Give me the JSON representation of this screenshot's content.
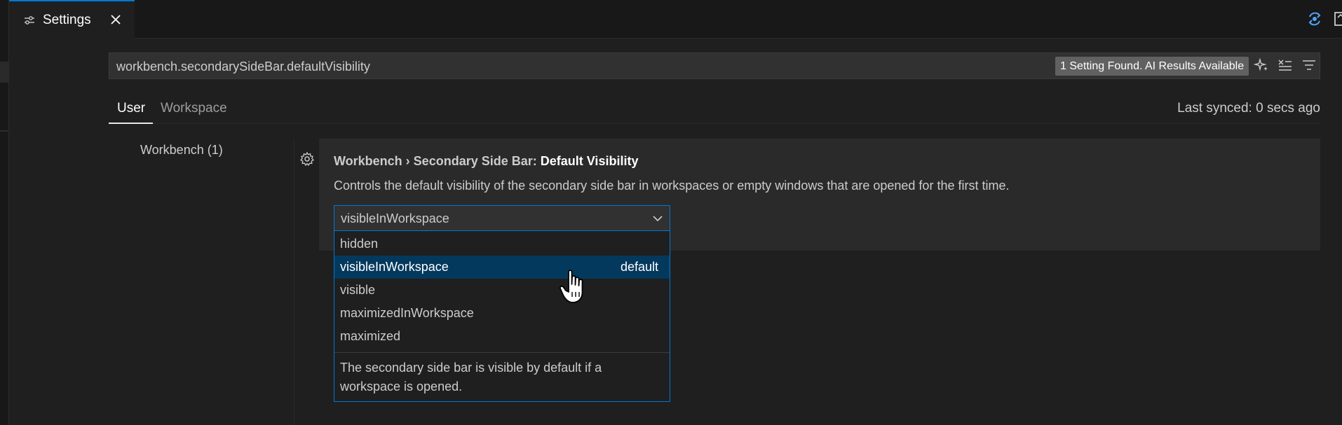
{
  "tab": {
    "title": "Settings",
    "icon": "settings-sliders-icon",
    "close_icon": "close-icon"
  },
  "top_right": {
    "icons": [
      "sync-icon",
      "open-settings-json-icon"
    ]
  },
  "search": {
    "query": "workbench.secondarySideBar.defaultVisibility",
    "result_badge": "1 Setting Found. AI Results Available",
    "actions": [
      "ai-sparkle-icon",
      "clear-filter-icon",
      "filter-icon"
    ]
  },
  "scope_tabs": {
    "user": "User",
    "workspace": "Workspace",
    "active": "User"
  },
  "sync_status": "Last synced: 0 secs ago",
  "toc": {
    "items": [
      {
        "label": "Workbench (1)"
      }
    ]
  },
  "setting": {
    "category": "Workbench › Secondary Side Bar: ",
    "name": "Default Visibility",
    "description": "Controls the default visibility of the secondary side bar in workspaces or empty windows that are opened for the first time.",
    "current_value": "visibleInWorkspace"
  },
  "dropdown": {
    "options": [
      {
        "label": "hidden"
      },
      {
        "label": "visibleInWorkspace",
        "tag": "default",
        "selected": true
      },
      {
        "label": "visible"
      },
      {
        "label": "maximizedInWorkspace"
      },
      {
        "label": "maximized"
      }
    ],
    "description": "The secondary side bar is visible by default if a workspace is opened."
  },
  "colors": {
    "accent": "#0078d4",
    "selected_option_bg": "#04395e",
    "badge_bg": "#616161",
    "background": "#1f1f1f"
  }
}
